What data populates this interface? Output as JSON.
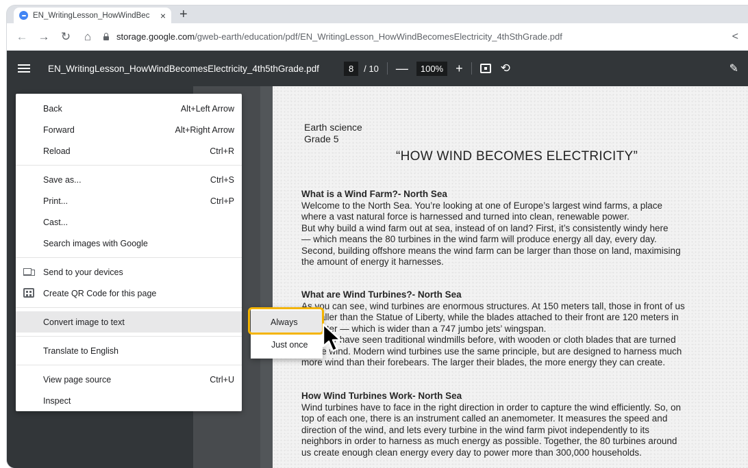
{
  "browser": {
    "tab_title": "EN_WritingLesson_HowWindBec",
    "tab_close": "×",
    "new_tab": "+",
    "nav": {
      "back": "←",
      "forward": "→",
      "reload": "↻",
      "home": "⌂"
    },
    "url_host": "storage.google.com",
    "url_path": "/gweb-earth/education/pdf/EN_WritingLesson_HowWindBecomesElectricity_4thSthGrade.pdf",
    "share_icon": "<"
  },
  "pdf_toolbar": {
    "filename": "EN_WritingLesson_HowWindBecomesElectricity_4th5thGrade.pdf",
    "page_current": "8",
    "page_total": "/ 10",
    "zoom_out": "—",
    "zoom_level": "100%",
    "zoom_in": "+",
    "rotate_icon": "⟲",
    "pen_icon": "✎"
  },
  "document": {
    "subject": "Earth science",
    "grade": "Grade 5",
    "title": "“HOW WIND BECOMES ELECTRICITY”",
    "sections": [
      {
        "heading": "What is a Wind Farm?- North Sea",
        "lines": [
          "Welcome to the North Sea. You’re looking at one of Europe’s largest wind farms, a place",
          "where a vast natural force is harnessed and turned into clean, renewable power.",
          "But why build a wind farm out at sea, instead of on land? First, it’s consistently windy here",
          "— which means the 80 turbines in the wind farm will produce energy all day, every day.",
          "Second, building offshore means the wind farm can be larger than those on land, maximising",
          "the amount of energy it harnesses."
        ]
      },
      {
        "heading": "What are Wind Turbines?- North Sea",
        "lines": [
          "As you can see, wind turbines are enormous structures. At 150 meters tall, those in front of us",
          "are taller than the Statue of Liberty, while the blades attached to their front are 120 meters in",
          "diameter — which is wider than a 747 jumbo jets’ wingspan.",
          "You may have seen traditional windmills before, with wooden or cloth blades that are turned",
          "by the wind. Modern wind turbines use the same principle, but are designed to harness much",
          "more wind than their forebears. The larger their blades, the more energy they can create."
        ]
      },
      {
        "heading": "How Wind Turbines Work- North Sea",
        "lines": [
          "Wind turbines have to face in the right direction in order to capture the wind efficiently. So, on",
          "top of each one, there is an instrument called an anemometer. It measures the speed and",
          "direction of the wind, and lets every turbine in the wind farm pivot independently to its",
          "neighbors in order to harness as much energy as possible. Together, the 80 turbines around",
          "us create enough clean energy every day to power more than 300,000 households."
        ]
      }
    ]
  },
  "context_menu": {
    "back": "Back",
    "back_sc": "Alt+Left Arrow",
    "forward": "Forward",
    "forward_sc": "Alt+Right Arrow",
    "reload": "Reload",
    "reload_sc": "Ctrl+R",
    "save_as": "Save as...",
    "save_as_sc": "Ctrl+S",
    "print": "Print...",
    "print_sc": "Ctrl+P",
    "cast": "Cast...",
    "search_images": "Search images with Google",
    "send_devices": "Send to your devices",
    "qr_code": "Create QR Code for this page",
    "convert_image": "Convert image to text",
    "translate": "Translate to English",
    "view_source": "View page source",
    "view_source_sc": "Ctrl+U",
    "inspect": "Inspect"
  },
  "submenu": {
    "always": "Always",
    "just_once": "Just once"
  },
  "colors": {
    "pdf_toolbar_bg": "#323639",
    "viewer_bg": "#525659",
    "focus_ring": "#f4b400"
  }
}
